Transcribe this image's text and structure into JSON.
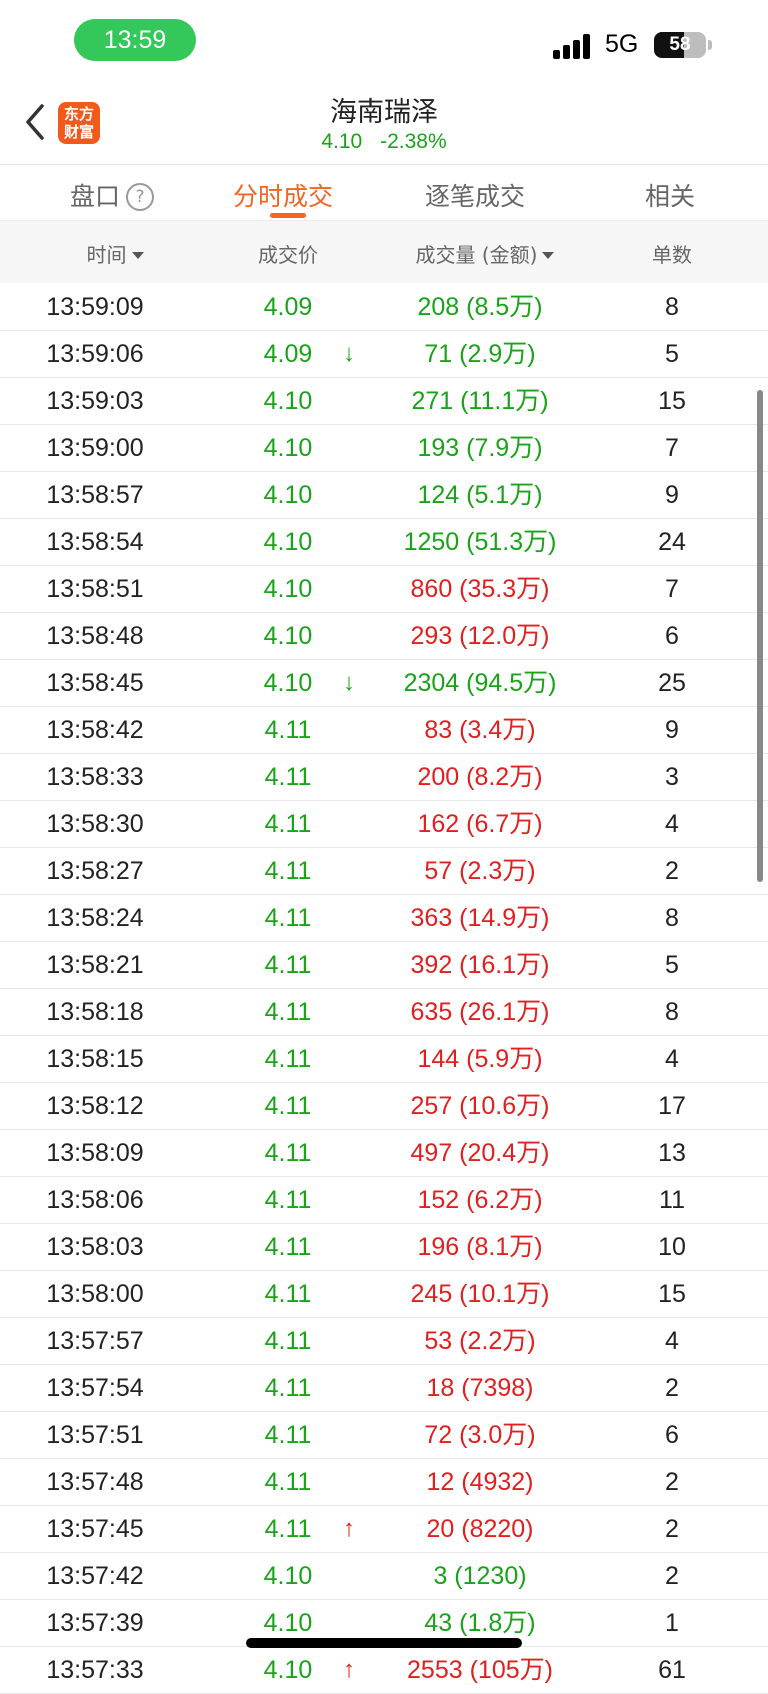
{
  "status_bar": {
    "time": "13:59",
    "network": "5G",
    "battery": "58",
    "battery_level": 0.58
  },
  "header": {
    "logo_text": "东方财富",
    "stock_name": "海南瑞泽",
    "price": "4.10",
    "change": "-2.38%"
  },
  "tabs": [
    {
      "label": "盘口",
      "active": false
    },
    {
      "label": "分时成交",
      "active": true
    },
    {
      "label": "逐笔成交",
      "active": false
    },
    {
      "label": "相关",
      "active": false
    }
  ],
  "help_icon_text": "?",
  "columns": {
    "time": "时间",
    "price": "成交价",
    "volume": "成交量 (金额)",
    "count": "单数"
  },
  "colors": {
    "up": "#e02020",
    "down": "#1aa31a",
    "accent": "#f26522"
  },
  "trades": [
    {
      "time": "13:59:09",
      "price": "4.09",
      "arrow": "",
      "volume": "208 (8.5万)",
      "vol_color": "green",
      "count": "8"
    },
    {
      "time": "13:59:06",
      "price": "4.09",
      "arrow": "↓",
      "volume": "71 (2.9万)",
      "vol_color": "green",
      "count": "5"
    },
    {
      "time": "13:59:03",
      "price": "4.10",
      "arrow": "",
      "volume": "271 (11.1万)",
      "vol_color": "green",
      "count": "15"
    },
    {
      "time": "13:59:00",
      "price": "4.10",
      "arrow": "",
      "volume": "193 (7.9万)",
      "vol_color": "green",
      "count": "7"
    },
    {
      "time": "13:58:57",
      "price": "4.10",
      "arrow": "",
      "volume": "124 (5.1万)",
      "vol_color": "green",
      "count": "9"
    },
    {
      "time": "13:58:54",
      "price": "4.10",
      "arrow": "",
      "volume": "1250 (51.3万)",
      "vol_color": "green",
      "count": "24"
    },
    {
      "time": "13:58:51",
      "price": "4.10",
      "arrow": "",
      "volume": "860 (35.3万)",
      "vol_color": "red",
      "count": "7"
    },
    {
      "time": "13:58:48",
      "price": "4.10",
      "arrow": "",
      "volume": "293 (12.0万)",
      "vol_color": "red",
      "count": "6"
    },
    {
      "time": "13:58:45",
      "price": "4.10",
      "arrow": "↓",
      "volume": "2304 (94.5万)",
      "vol_color": "green",
      "count": "25"
    },
    {
      "time": "13:58:42",
      "price": "4.11",
      "arrow": "",
      "volume": "83 (3.4万)",
      "vol_color": "red",
      "count": "9"
    },
    {
      "time": "13:58:33",
      "price": "4.11",
      "arrow": "",
      "volume": "200 (8.2万)",
      "vol_color": "red",
      "count": "3"
    },
    {
      "time": "13:58:30",
      "price": "4.11",
      "arrow": "",
      "volume": "162 (6.7万)",
      "vol_color": "red",
      "count": "4"
    },
    {
      "time": "13:58:27",
      "price": "4.11",
      "arrow": "",
      "volume": "57 (2.3万)",
      "vol_color": "red",
      "count": "2"
    },
    {
      "time": "13:58:24",
      "price": "4.11",
      "arrow": "",
      "volume": "363 (14.9万)",
      "vol_color": "red",
      "count": "8"
    },
    {
      "time": "13:58:21",
      "price": "4.11",
      "arrow": "",
      "volume": "392 (16.1万)",
      "vol_color": "red",
      "count": "5"
    },
    {
      "time": "13:58:18",
      "price": "4.11",
      "arrow": "",
      "volume": "635 (26.1万)",
      "vol_color": "red",
      "count": "8"
    },
    {
      "time": "13:58:15",
      "price": "4.11",
      "arrow": "",
      "volume": "144 (5.9万)",
      "vol_color": "red",
      "count": "4"
    },
    {
      "time": "13:58:12",
      "price": "4.11",
      "arrow": "",
      "volume": "257 (10.6万)",
      "vol_color": "red",
      "count": "17"
    },
    {
      "time": "13:58:09",
      "price": "4.11",
      "arrow": "",
      "volume": "497 (20.4万)",
      "vol_color": "red",
      "count": "13"
    },
    {
      "time": "13:58:06",
      "price": "4.11",
      "arrow": "",
      "volume": "152 (6.2万)",
      "vol_color": "red",
      "count": "11"
    },
    {
      "time": "13:58:03",
      "price": "4.11",
      "arrow": "",
      "volume": "196 (8.1万)",
      "vol_color": "red",
      "count": "10"
    },
    {
      "time": "13:58:00",
      "price": "4.11",
      "arrow": "",
      "volume": "245 (10.1万)",
      "vol_color": "red",
      "count": "15"
    },
    {
      "time": "13:57:57",
      "price": "4.11",
      "arrow": "",
      "volume": "53 (2.2万)",
      "vol_color": "red",
      "count": "4"
    },
    {
      "time": "13:57:54",
      "price": "4.11",
      "arrow": "",
      "volume": "18 (7398)",
      "vol_color": "red",
      "count": "2"
    },
    {
      "time": "13:57:51",
      "price": "4.11",
      "arrow": "",
      "volume": "72 (3.0万)",
      "vol_color": "red",
      "count": "6"
    },
    {
      "time": "13:57:48",
      "price": "4.11",
      "arrow": "",
      "volume": "12 (4932)",
      "vol_color": "red",
      "count": "2"
    },
    {
      "time": "13:57:45",
      "price": "4.11",
      "arrow": "↑",
      "volume": "20 (8220)",
      "vol_color": "red",
      "count": "2"
    },
    {
      "time": "13:57:42",
      "price": "4.10",
      "arrow": "",
      "volume": "3 (1230)",
      "vol_color": "green",
      "count": "2"
    },
    {
      "time": "13:57:39",
      "price": "4.10",
      "arrow": "",
      "volume": "43 (1.8万)",
      "vol_color": "green",
      "count": "1"
    },
    {
      "time": "13:57:33",
      "price": "4.10",
      "arrow": "↑",
      "volume": "2553 (105万)",
      "vol_color": "red",
      "count": "61"
    }
  ]
}
